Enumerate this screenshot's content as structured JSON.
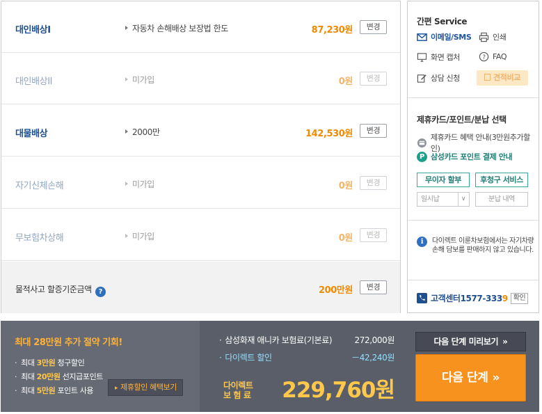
{
  "coverage": {
    "rows": [
      {
        "name": "대인배상I",
        "desc": "자동차 손해배상 보장법 한도",
        "amount": "87,230원",
        "button": "변경"
      },
      {
        "name": "대인배상II",
        "desc": "미가입",
        "amount": "0원",
        "button": "변경"
      },
      {
        "name": "대물배상",
        "desc": "2000만",
        "amount": "142,530원",
        "button": "변경"
      },
      {
        "name": "자기신체손해",
        "desc": "미가입",
        "amount": "0원",
        "button": "변경"
      },
      {
        "name": "무보험차상해",
        "desc": "미가입",
        "amount": "0원",
        "button": "변경"
      }
    ],
    "threshold": {
      "label": "물적사고 할증기준금액",
      "help": "?",
      "amount": "200만원",
      "button": "변경"
    }
  },
  "side": {
    "service_title": "간편 Service",
    "email": "이메일/SMS",
    "print": "인쇄",
    "capture": "화면 캡처",
    "faq": "FAQ",
    "consult": "상담 신청",
    "compare": "견적비교",
    "card_title": "제휴카드/포인트/분납 선택",
    "card_benefit": "제휴카드 혜택 안내(3만원추가할인)",
    "samsung_card": "삼성카드 포인트 결제 안내",
    "p_badge": "P",
    "installment_free": "무이자 할부",
    "postpay_service": "후청구 서비스",
    "lump_sum": "일시납",
    "installment_detail": "분납 내역",
    "info_icon": "i",
    "notice": "다이렉트 이륜차보험에서는 자기차량손해 담보를 판매하지 않고 있습니다.",
    "cs_label": "고객센터",
    "cs_number_main": "1577-333",
    "cs_number_last": "9",
    "cs_confirm": "확인"
  },
  "bottom": {
    "promo_title": "최대 28만원 추가 절약 기회!",
    "promo_items": [
      {
        "pre": "최대 ",
        "hl": "3만원",
        "post": " 청구할인"
      },
      {
        "pre": "최대 ",
        "hl": "20만원",
        "post": " 선지급포인트"
      },
      {
        "pre": "최대 ",
        "hl": "5만원",
        "post": " 포인트 사용"
      }
    ],
    "benefit_button": "제휴할인 혜택보기",
    "base_label": "삼성화재 애니카 보험료(기본료)",
    "base_value": "272,000원",
    "discount_label": "다이렉트 할인",
    "discount_value": "－42,240원",
    "total_label": "다이렉트 보 험 료",
    "total_value": "229,760원",
    "preview_button": "다음 단계 미리보기",
    "next_button": "다음 단계"
  },
  "colors": {
    "accent_orange": "#f7921e",
    "navy": "#1e4f8f",
    "bar_bg": "#5a5e69",
    "highlight_yellow": "#ffc84a"
  }
}
